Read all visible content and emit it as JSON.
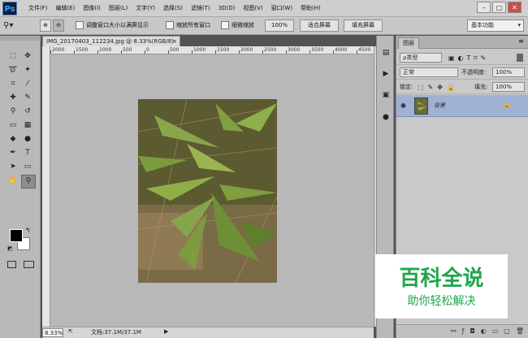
{
  "app": {
    "logo": "Ps"
  },
  "menu": [
    "文件(F)",
    "编辑(E)",
    "图像(I)",
    "图层(L)",
    "文字(Y)",
    "选择(S)",
    "滤镜(T)",
    "3D(D)",
    "视图(V)",
    "窗口(W)",
    "帮助(H)"
  ],
  "window_controls": {
    "minimize": "–",
    "maximize": "□",
    "close": "✕"
  },
  "options": {
    "resize_windows_label": "调整窗口大小以满屏显示",
    "zoom_all_label": "缩放所有窗口",
    "scrubby_zoom_label": "细微缩放",
    "zoom_percent": "100%",
    "fit_screen": "适合屏幕",
    "fill_screen": "填充屏幕",
    "workspace": "基本功能"
  },
  "document": {
    "tab_title": "IMG_20170403_112234.jpg @ 8.33%(RGB/8)",
    "tab_close": "×",
    "zoom": "8.33%",
    "doc_info": "文档:37.1M/37.1M"
  },
  "ruler": {
    "ticks": [
      "2000",
      "1500",
      "1000",
      "500",
      "0",
      "500",
      "1000",
      "1500",
      "2000",
      "2500",
      "3000",
      "3500",
      "4000",
      "4500"
    ]
  },
  "tools": [
    {
      "name": "marquee-icon",
      "glyph": "⬚"
    },
    {
      "name": "move-icon",
      "glyph": "✥"
    },
    {
      "name": "lasso-icon",
      "glyph": "➰"
    },
    {
      "name": "magic-wand-icon",
      "glyph": "✦"
    },
    {
      "name": "crop-icon",
      "glyph": "⌗"
    },
    {
      "name": "eyedropper-icon",
      "glyph": "⁄"
    },
    {
      "name": "healing-icon",
      "glyph": "✚"
    },
    {
      "name": "brush-icon",
      "glyph": "✎"
    },
    {
      "name": "stamp-icon",
      "glyph": "⚲"
    },
    {
      "name": "history-brush-icon",
      "glyph": "↺"
    },
    {
      "name": "eraser-icon",
      "glyph": "▭"
    },
    {
      "name": "gradient-icon",
      "glyph": "▦"
    },
    {
      "name": "blur-icon",
      "glyph": "◆"
    },
    {
      "name": "dodge-icon",
      "glyph": "●"
    },
    {
      "name": "pen-icon",
      "glyph": "✒"
    },
    {
      "name": "type-icon",
      "glyph": "T"
    },
    {
      "name": "path-select-icon",
      "glyph": "➤"
    },
    {
      "name": "shape-icon",
      "glyph": "▭"
    },
    {
      "name": "hand-icon",
      "glyph": "✋"
    },
    {
      "name": "zoom-icon",
      "glyph": "⚲"
    }
  ],
  "layers": {
    "tab": "图层",
    "filter_kind": "ρ类型",
    "blend_mode": "正常",
    "opacity_label": "不透明度:",
    "opacity_value": "100%",
    "lock_label": "锁定:",
    "fill_label": "填充:",
    "fill_value": "100%",
    "layer_name": "背景"
  },
  "watermark": {
    "title": "百科全说",
    "subtitle": "助你轻松解决"
  }
}
